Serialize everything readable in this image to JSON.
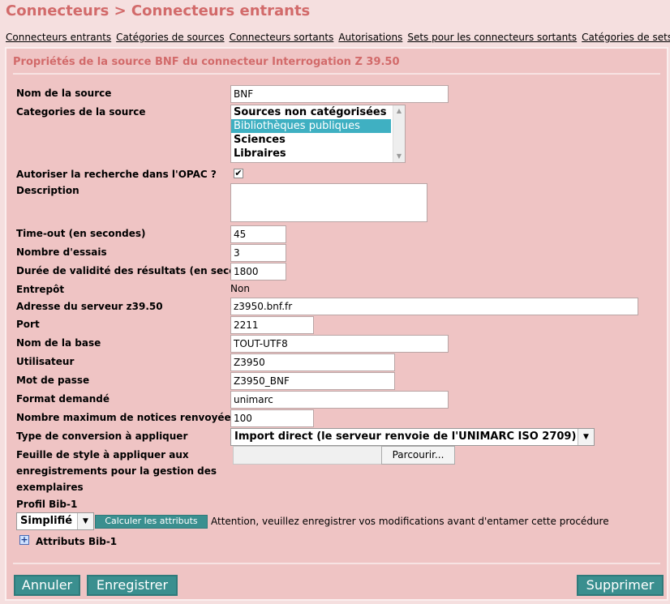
{
  "page": {
    "title": "Connecteurs > Connecteurs entrants"
  },
  "nav": {
    "items": [
      "Connecteurs entrants",
      "Catégories de sources",
      "Connecteurs sortants",
      "Autorisations",
      "Sets pour les connecteurs sortants",
      "Catégories de sets"
    ]
  },
  "form": {
    "title": "Propriétés de la source BNF du connecteur Interrogation Z 39.50",
    "labels": {
      "source_name": "Nom de la source",
      "categories": "Categories de la source",
      "opac": "Autoriser la recherche dans l'OPAC ?",
      "description": "Description",
      "timeout": "Time-out (en secondes)",
      "retries": "Nombre d'essais",
      "validity": "Durée de validité des résultats (en secondes)",
      "warehouse": "Entrepôt",
      "server": "Adresse du serveur z39.50",
      "port": "Port",
      "base": "Nom de la base",
      "user": "Utilisateur",
      "password": "Mot de passe",
      "format": "Format demandé",
      "max_records": "Nombre maximum de notices renvoyées",
      "conversion": "Type de conversion à appliquer",
      "stylesheet_1": "Feuille de style à appliquer aux",
      "stylesheet_2": "enregistrements pour la gestion des",
      "stylesheet_3": "exemplaires",
      "profile": "Profil Bib-1"
    },
    "values": {
      "source_name": "BNF",
      "timeout": "45",
      "retries": "3",
      "validity": "1800",
      "warehouse": "Non",
      "server": "z3950.bnf.fr",
      "port": "2211",
      "base": "TOUT-UTF8",
      "user": "Z3950",
      "password": "Z3950_BNF",
      "format": "unimarc",
      "max_records": "100",
      "conversion": "Import direct (le serveur renvoie de l'UNIMARC ISO 2709)",
      "profile": "Simplifié",
      "description": ""
    },
    "categories_options": [
      "Sources non catégorisées",
      "Bibliothèques publiques",
      "Sciences",
      "Libraires"
    ],
    "categories_selected": "Bibliothèques publiques",
    "opac_checked": true,
    "browse_label": "Parcourir...",
    "calc_button": "Calculer les attributs",
    "warning": "Attention, veuillez enregistrer vos modifications avant d'entamer cette procédure",
    "attributes_label": "Attributs Bib-1"
  },
  "footer": {
    "cancel": "Annuler",
    "save": "Enregistrer",
    "delete": "Supprimer"
  },
  "colors": {
    "title": "#d26a6a",
    "panel": "#efc4c4",
    "button": "#3a8f8f",
    "selection": "#3fb0c2"
  }
}
